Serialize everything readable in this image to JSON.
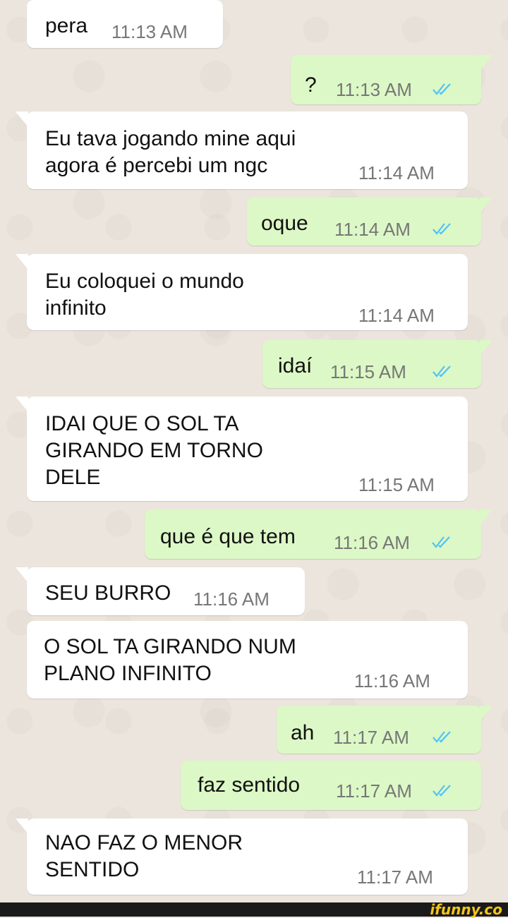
{
  "colors": {
    "incoming": "#ffffff",
    "outgoing": "#dcf8c6",
    "ticks": "#4fc3f7",
    "watermark": "#f5c518"
  },
  "messages": [
    {
      "dir": "in",
      "text": "pera",
      "time": "11:13 AM"
    },
    {
      "dir": "out",
      "text": "?",
      "time": "11:13 AM",
      "status": "read-double-tick-icon"
    },
    {
      "dir": "in",
      "text": "Eu tava jogando mine aqui\nagora é percebi um ngc",
      "time": "11:14 AM"
    },
    {
      "dir": "out",
      "text": "oque",
      "time": "11:14 AM",
      "status": "read-double-tick-icon"
    },
    {
      "dir": "in",
      "text": "Eu coloquei o mundo\ninfinito",
      "time": "11:14 AM"
    },
    {
      "dir": "out",
      "text": "idaí",
      "time": "11:15 AM",
      "status": "read-double-tick-icon"
    },
    {
      "dir": "in",
      "text": "IDAI QUE O SOL TA\nGIRANDO EM TORNO\nDELE",
      "time": "11:15 AM"
    },
    {
      "dir": "out",
      "text": "que é que tem",
      "time": "11:16 AM",
      "status": "read-double-tick-icon"
    },
    {
      "dir": "in",
      "text": "SEU BURRO",
      "time": "11:16 AM"
    },
    {
      "dir": "in",
      "text": "O SOL TA GIRANDO NUM\nPLANO INFINITO",
      "time": "11:16 AM"
    },
    {
      "dir": "out",
      "text": "ah",
      "time": "11:17 AM",
      "status": "read-double-tick-icon"
    },
    {
      "dir": "out",
      "text": "faz sentido",
      "time": "11:17 AM",
      "status": "read-double-tick-icon"
    },
    {
      "dir": "in",
      "text": "NAO FAZ O MENOR\nSENTIDO",
      "time": "11:17 AM"
    }
  ],
  "watermark": "ifunny.co"
}
